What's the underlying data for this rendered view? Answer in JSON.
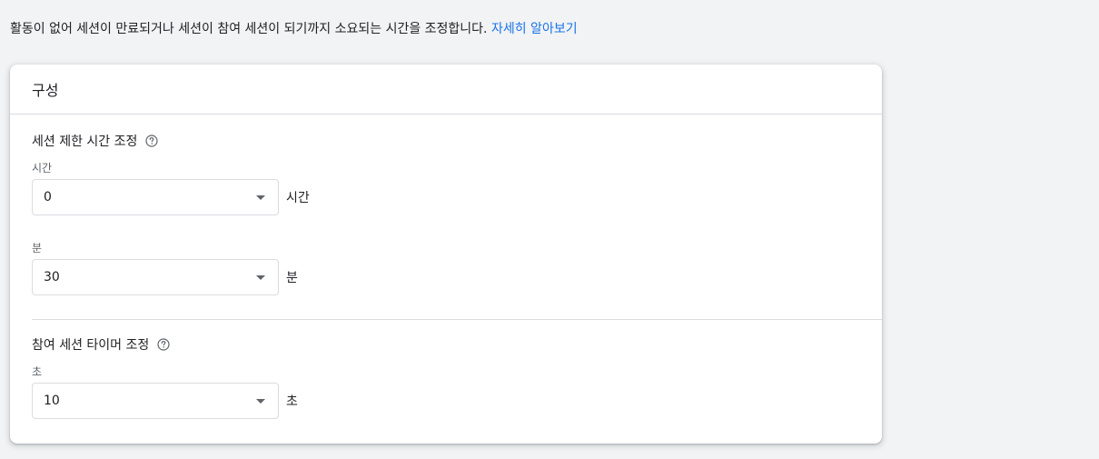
{
  "intro": {
    "text": "활동이 없어 세션이 만료되거나 세션이 참여 세션이 되기까지 소요되는 시간을 조정합니다. ",
    "link": "자세히 알아보기"
  },
  "card": {
    "title": "구성",
    "session_timeout": {
      "title": "세션 제한 시간 조정",
      "hours": {
        "label": "시간",
        "value": "0",
        "unit": "시간"
      },
      "minutes": {
        "label": "분",
        "value": "30",
        "unit": "분"
      }
    },
    "engaged_timer": {
      "title": "참여 세션 타이머 조정",
      "seconds": {
        "label": "초",
        "value": "10",
        "unit": "초"
      }
    }
  },
  "icons": {
    "help": "help-circle-icon",
    "dropdown": "caret-down-icon"
  },
  "colors": {
    "link": "#1a73e8",
    "background": "#f1f3f4"
  }
}
